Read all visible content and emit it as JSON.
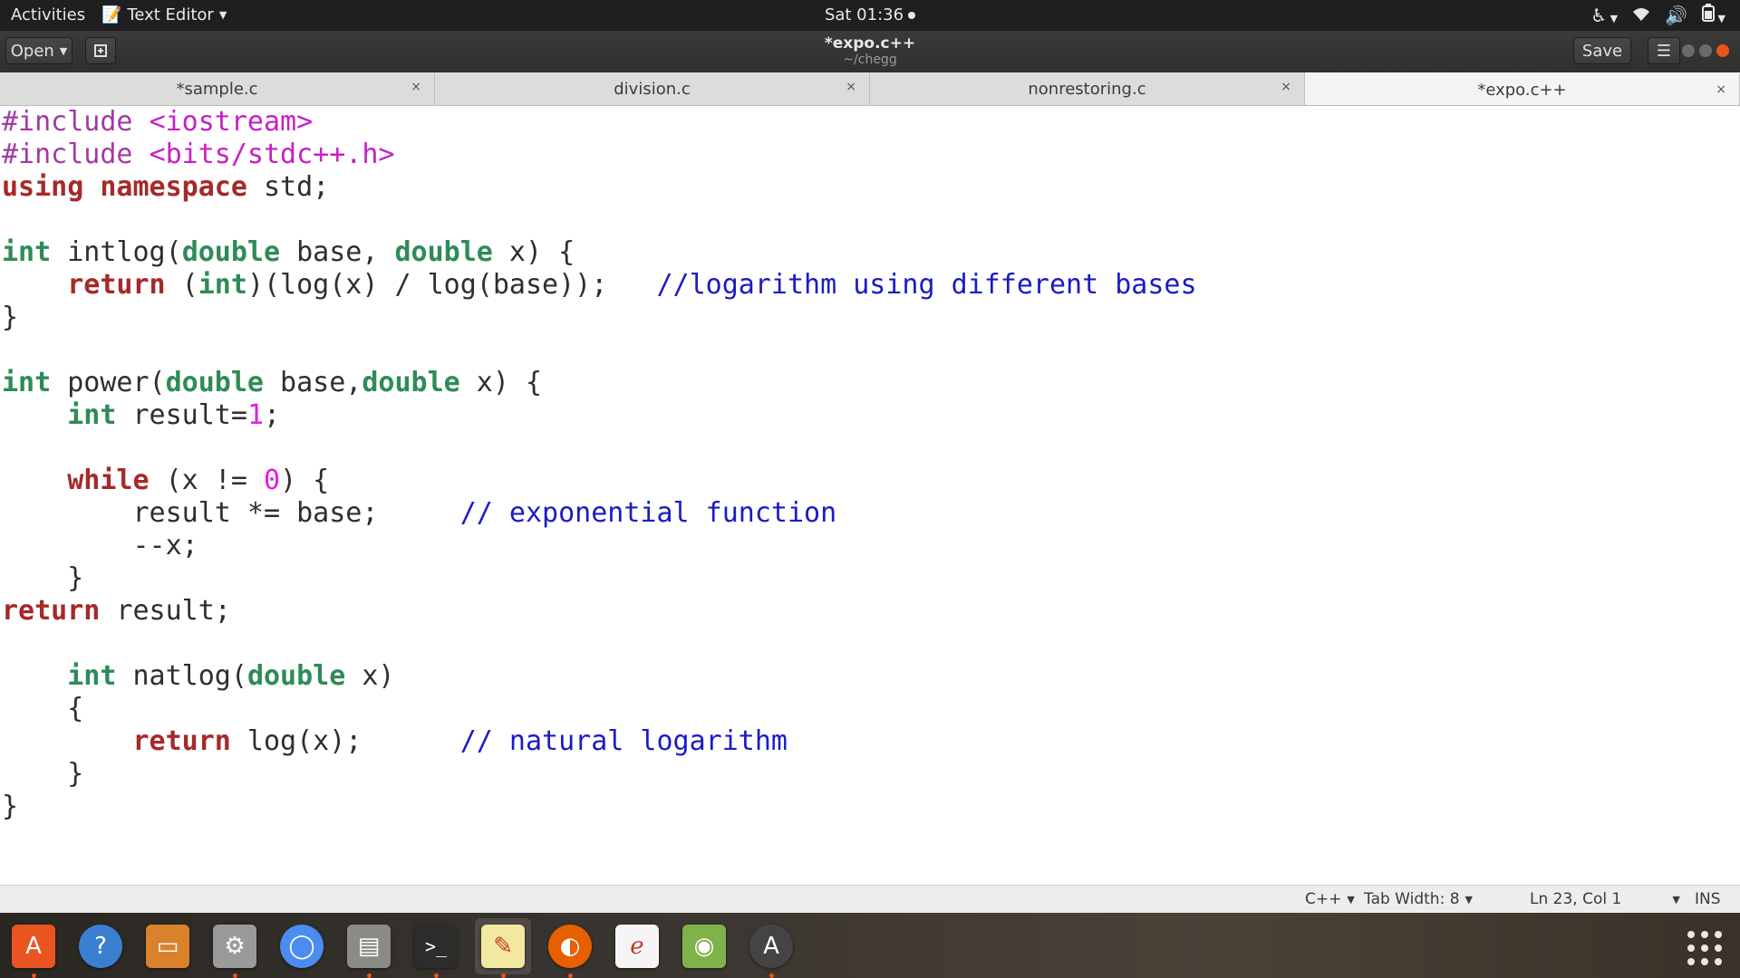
{
  "topbar": {
    "activities": "Activities",
    "app_name": "Text Editor",
    "clock": "Sat 01:36"
  },
  "headerbar": {
    "open_label": "Open",
    "save_label": "Save",
    "title": "*expo.c++",
    "subtitle": "~/chegg"
  },
  "tabs": [
    {
      "label": "*sample.c"
    },
    {
      "label": "division.c"
    },
    {
      "label": "nonrestoring.c"
    },
    {
      "label": "*expo.c++"
    }
  ],
  "editor": {
    "lines": [
      [
        {
          "t": "#include ",
          "c": "pp"
        },
        {
          "t": "<iostream>",
          "c": "str"
        }
      ],
      [
        {
          "t": "#include ",
          "c": "pp"
        },
        {
          "t": "<bits/stdc++.h>",
          "c": "str"
        }
      ],
      [
        {
          "t": "using",
          "c": "kw"
        },
        {
          "t": " "
        },
        {
          "t": "namespace",
          "c": "kw"
        },
        {
          "t": " std;"
        }
      ],
      [],
      [
        {
          "t": "int",
          "c": "ty"
        },
        {
          "t": " intlog("
        },
        {
          "t": "double",
          "c": "ty"
        },
        {
          "t": " base, "
        },
        {
          "t": "double",
          "c": "ty"
        },
        {
          "t": " x) {"
        }
      ],
      [
        {
          "t": "    "
        },
        {
          "t": "return",
          "c": "kw"
        },
        {
          "t": " ("
        },
        {
          "t": "int",
          "c": "ty"
        },
        {
          "t": ")(log(x) / log(base));   "
        },
        {
          "t": "//logarithm using different bases",
          "c": "cm"
        }
      ],
      [
        {
          "t": "}"
        }
      ],
      [],
      [
        {
          "t": "int",
          "c": "ty"
        },
        {
          "t": " power("
        },
        {
          "t": "double",
          "c": "ty"
        },
        {
          "t": " base,"
        },
        {
          "t": "double",
          "c": "ty"
        },
        {
          "t": " x) {"
        }
      ],
      [
        {
          "t": "    "
        },
        {
          "t": "int",
          "c": "ty"
        },
        {
          "t": " result="
        },
        {
          "t": "1",
          "c": "num"
        },
        {
          "t": ";"
        }
      ],
      [],
      [
        {
          "t": "    "
        },
        {
          "t": "while",
          "c": "kw"
        },
        {
          "t": " (x != "
        },
        {
          "t": "0",
          "c": "num"
        },
        {
          "t": ") {"
        }
      ],
      [
        {
          "t": "        result *= base;     "
        },
        {
          "t": "// exponential function",
          "c": "cm"
        }
      ],
      [
        {
          "t": "        --x;"
        }
      ],
      [
        {
          "t": "    }"
        }
      ],
      [
        {
          "t": "return",
          "c": "kw"
        },
        {
          "t": " result;"
        }
      ],
      [],
      [
        {
          "t": "    "
        },
        {
          "t": "int",
          "c": "ty"
        },
        {
          "t": " natlog("
        },
        {
          "t": "double",
          "c": "ty"
        },
        {
          "t": " x)"
        }
      ],
      [
        {
          "t": "    {"
        }
      ],
      [
        {
          "t": "        "
        },
        {
          "t": "return",
          "c": "kw"
        },
        {
          "t": " log(x);      "
        },
        {
          "t": "// natural logarithm",
          "c": "cm"
        }
      ],
      [
        {
          "t": "    }"
        }
      ],
      [
        {
          "t": "}"
        }
      ]
    ]
  },
  "statusbar": {
    "language": "C++",
    "tab_width": "Tab Width: 8",
    "position": "Ln 23, Col 1",
    "mode": "INS"
  },
  "dock": [
    {
      "icon": "software-center-icon",
      "color": "#e95420",
      "running": true
    },
    {
      "icon": "help-icon",
      "color": "#3b7fd1",
      "running": false
    },
    {
      "icon": "files-folder-icon",
      "color": "#d9822b",
      "running": false
    },
    {
      "icon": "settings-tools-icon",
      "color": "#9a9a9a",
      "running": true
    },
    {
      "icon": "chromium-icon",
      "color": "#4a8cf0",
      "running": false
    },
    {
      "icon": "file-cabinet-icon",
      "color": "#8a8a86",
      "running": true
    },
    {
      "icon": "terminal-icon",
      "color": "#2c2c2c",
      "running": true
    },
    {
      "icon": "text-editor-icon",
      "color": "#f3e8a0",
      "running": true,
      "active": true
    },
    {
      "icon": "firefox-icon",
      "color": "#e66000",
      "running": true
    },
    {
      "icon": "document-viewer-icon",
      "color": "#f5f5f5",
      "running": false
    },
    {
      "icon": "image-viewer-icon",
      "color": "#7fb24a",
      "running": false
    },
    {
      "icon": "software-updater-icon",
      "color": "#444444",
      "running": true
    }
  ]
}
